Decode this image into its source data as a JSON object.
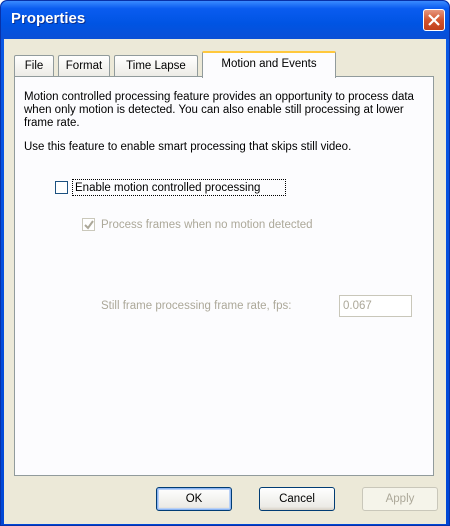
{
  "window": {
    "title": "Properties"
  },
  "tabs": [
    {
      "label": "File"
    },
    {
      "label": "Format"
    },
    {
      "label": "Time Lapse"
    },
    {
      "label": "Motion and Events"
    }
  ],
  "panel": {
    "description_1": "Motion controlled processing feature provides an opportunity to process data when only motion is detected. You can also enable still processing at lower frame rate.",
    "description_2": "Use this feature to enable smart processing that skips still video.",
    "enable_checkbox": {
      "label": "Enable motion controlled processing",
      "checked": false
    },
    "process_frames_checkbox": {
      "label": "Process frames when no motion detected",
      "checked": true,
      "enabled": false
    },
    "fps_label": "Still frame processing frame rate, fps:",
    "fps_value": "0.067"
  },
  "buttons": {
    "ok": "OK",
    "cancel": "Cancel",
    "apply": "Apply"
  },
  "colors": {
    "titlebar": "#0054e3",
    "dialog_bg": "#ece9d8",
    "active_tab_accent": "#ffc83c",
    "close_button": "#d3542e"
  }
}
